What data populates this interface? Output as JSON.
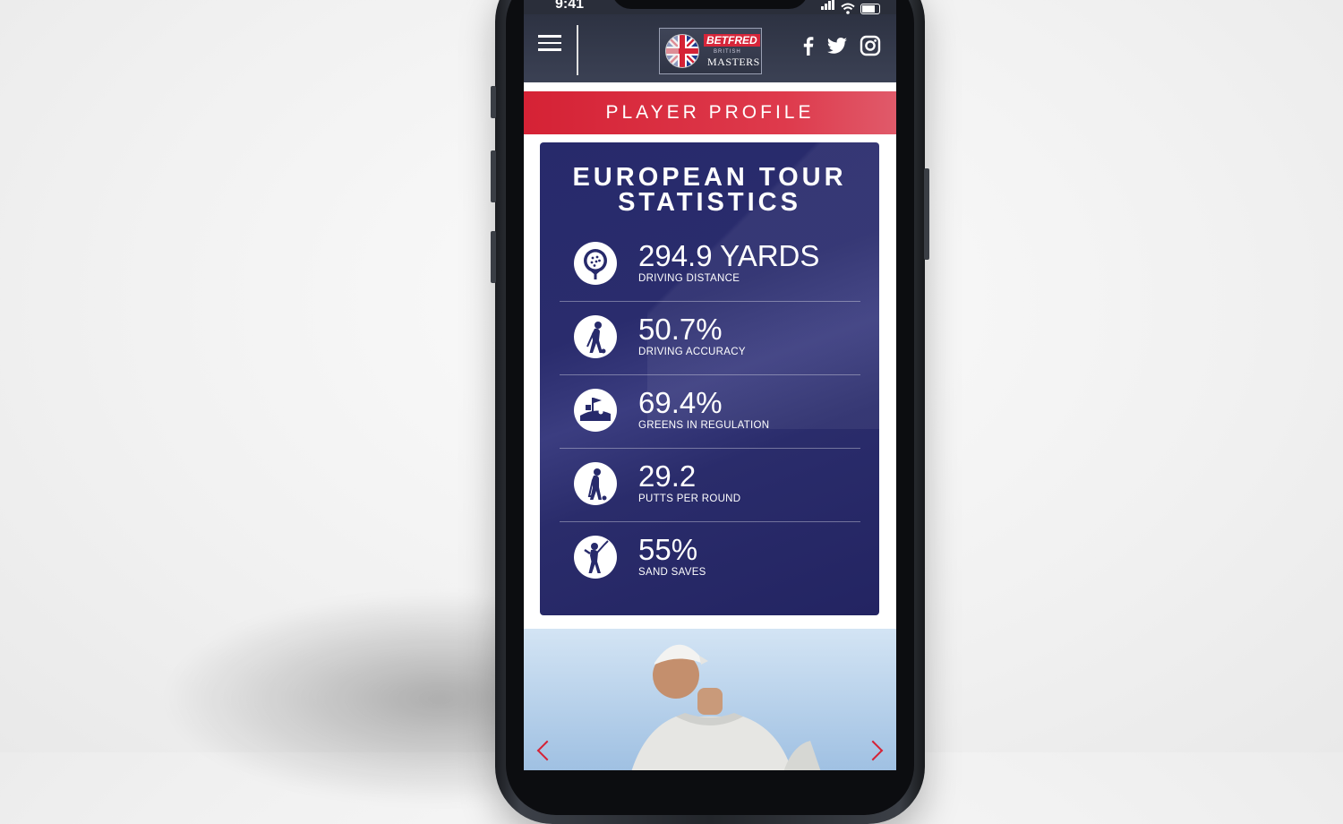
{
  "status_bar": {
    "time": "9:41"
  },
  "header": {
    "logo": {
      "sponsor": "BETFRED",
      "subtitle": "BRITISH",
      "name": "MASTERS"
    }
  },
  "banner": {
    "title": "PLAYER PROFILE"
  },
  "stats": {
    "title_line1": "EUROPEAN TOUR",
    "title_line2": "STATISTICS",
    "items": [
      {
        "value": "294.9 YARDS",
        "label": "DRIVING DISTANCE",
        "icon": "golf-ball-tee-icon"
      },
      {
        "value": "50.7%",
        "label": "DRIVING ACCURACY",
        "icon": "golfer-address-icon"
      },
      {
        "value": "69.4%",
        "label": "GREENS IN REGULATION",
        "icon": "flag-green-icon"
      },
      {
        "value": "29.2",
        "label": "PUTTS PER ROUND",
        "icon": "putter-icon"
      },
      {
        "value": "55%",
        "label": "SAND SAVES",
        "icon": "golfer-swing-icon"
      }
    ]
  },
  "colors": {
    "accent_red": "#d52235",
    "card_navy": "#272a6b",
    "header_dark": "#2d3242"
  }
}
